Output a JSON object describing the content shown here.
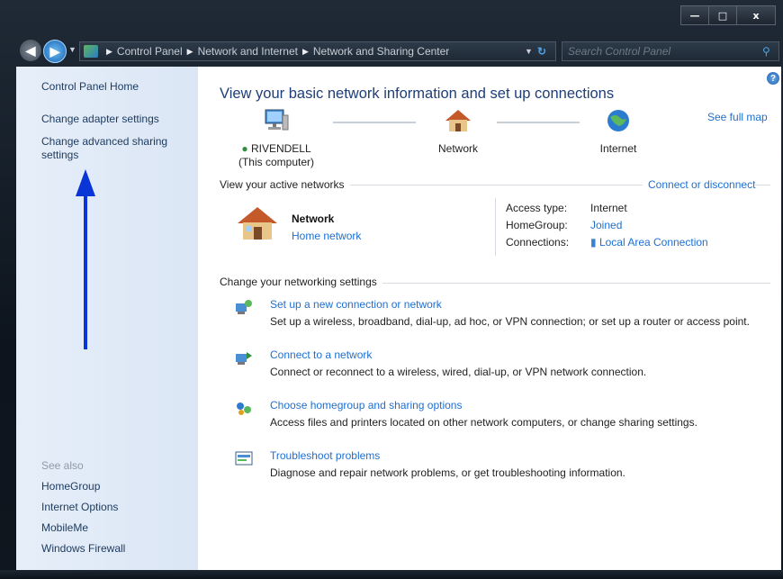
{
  "window": {
    "minimize_glyph": "—",
    "maximize_glyph": "□",
    "close_glyph": "x"
  },
  "address": {
    "crumbs": [
      "Control Panel",
      "Network and Internet",
      "Network and Sharing Center"
    ],
    "search_placeholder": "Search Control Panel"
  },
  "sidebar": {
    "home": "Control Panel Home",
    "change_adapter": "Change adapter settings",
    "change_advanced_line1": "Change advanced sharing",
    "change_advanced_line2": "settings",
    "see_also": "See also",
    "links": [
      "HomeGroup",
      "Internet Options",
      "MobileMe",
      "Windows Firewall"
    ]
  },
  "main": {
    "heading": "View your basic network information and set up connections",
    "see_full_map": "See full map",
    "map": {
      "computer_name": "RIVENDELL",
      "computer_sub": "(This computer)",
      "network": "Network",
      "internet": "Internet"
    },
    "active_networks_label": "View your active networks",
    "connect_or_disconnect": "Connect or disconnect",
    "active_network": {
      "name": "Network",
      "type": "Home network",
      "access_type_label": "Access type:",
      "access_type_value": "Internet",
      "homegroup_label": "HomeGroup:",
      "homegroup_value": "Joined",
      "connections_label": "Connections:",
      "connections_value": "Local Area Connection"
    },
    "change_settings_label": "Change your networking settings",
    "tasks": [
      {
        "title": "Set up a new connection or network",
        "desc": "Set up a wireless, broadband, dial-up, ad hoc, or VPN connection; or set up a router or access point."
      },
      {
        "title": "Connect to a network",
        "desc": "Connect or reconnect to a wireless, wired, dial-up, or VPN network connection."
      },
      {
        "title": "Choose homegroup and sharing options",
        "desc": "Access files and printers located on other network computers, or change sharing settings."
      },
      {
        "title": "Troubleshoot problems",
        "desc": "Diagnose and repair network problems, or get troubleshooting information."
      }
    ]
  },
  "colors": {
    "link": "#1f6fd1",
    "heading": "#1e3e78",
    "sidebar_bg": "#dbe6f5",
    "annotation_arrow": "#0a35d6"
  }
}
